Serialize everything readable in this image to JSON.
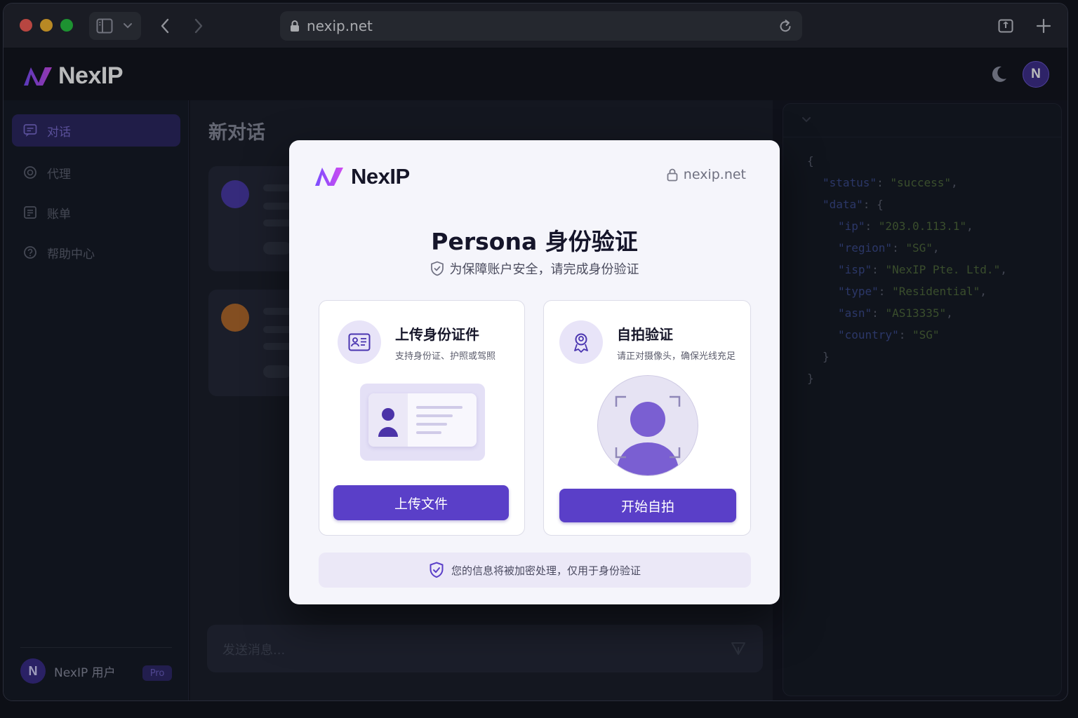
{
  "browser": {
    "url": "nexip.net"
  },
  "app": {
    "brand": "NexIP",
    "avatar_letter": "N"
  },
  "sidebar": {
    "items": [
      {
        "label": "对话",
        "icon": "chat-icon",
        "active": true
      },
      {
        "label": "代理",
        "icon": "globe-icon",
        "active": false
      },
      {
        "label": "账单",
        "icon": "bill-icon",
        "active": false
      },
      {
        "label": "帮助中心",
        "icon": "help-icon",
        "active": false
      }
    ],
    "user": {
      "avatar_letter": "N",
      "name": "NexIP 用户",
      "badge": "Pro"
    }
  },
  "main": {
    "title": "新对话",
    "composer_placeholder": "发送消息..."
  },
  "json_panel": {
    "lines": [
      {
        "indent": 0,
        "text": "{"
      },
      {
        "indent": 1,
        "key": "status",
        "value": "success",
        "comma": true
      },
      {
        "indent": 1,
        "key": "data",
        "open": "{"
      },
      {
        "indent": 2,
        "key": "ip",
        "value": "203.0.113.1",
        "comma": true
      },
      {
        "indent": 2,
        "key": "region",
        "value": "SG",
        "comma": true
      },
      {
        "indent": 2,
        "key": "isp",
        "value": "NexIP Pte. Ltd.",
        "comma": true
      },
      {
        "indent": 2,
        "key": "type",
        "value": "Residential",
        "comma": true
      },
      {
        "indent": 2,
        "key": "asn",
        "value": "AS13335",
        "comma": true
      },
      {
        "indent": 2,
        "key": "country",
        "value": "SG",
        "comma": false
      },
      {
        "indent": 1,
        "text": "}"
      },
      {
        "indent": 0,
        "text": "}"
      }
    ]
  },
  "modal": {
    "brand": "NexIP",
    "domain": "nexip.net",
    "title": "Persona 身份验证",
    "subtitle": "为保障账户安全，请完成身份验证",
    "options": {
      "upload": {
        "title": "上传身份证件",
        "desc": "支持身份证、护照或驾照",
        "button": "上传文件"
      },
      "selfie": {
        "title": "自拍验证",
        "desc": "请正对摄像头，确保光线充足",
        "button": "开始自拍"
      }
    },
    "footer": "您的信息将被加密处理，仅用于身份验证"
  },
  "colors": {
    "accent": "#5a3fc8",
    "brand_gradient_start": "#7b4dff",
    "brand_gradient_end": "#d04cf0"
  }
}
